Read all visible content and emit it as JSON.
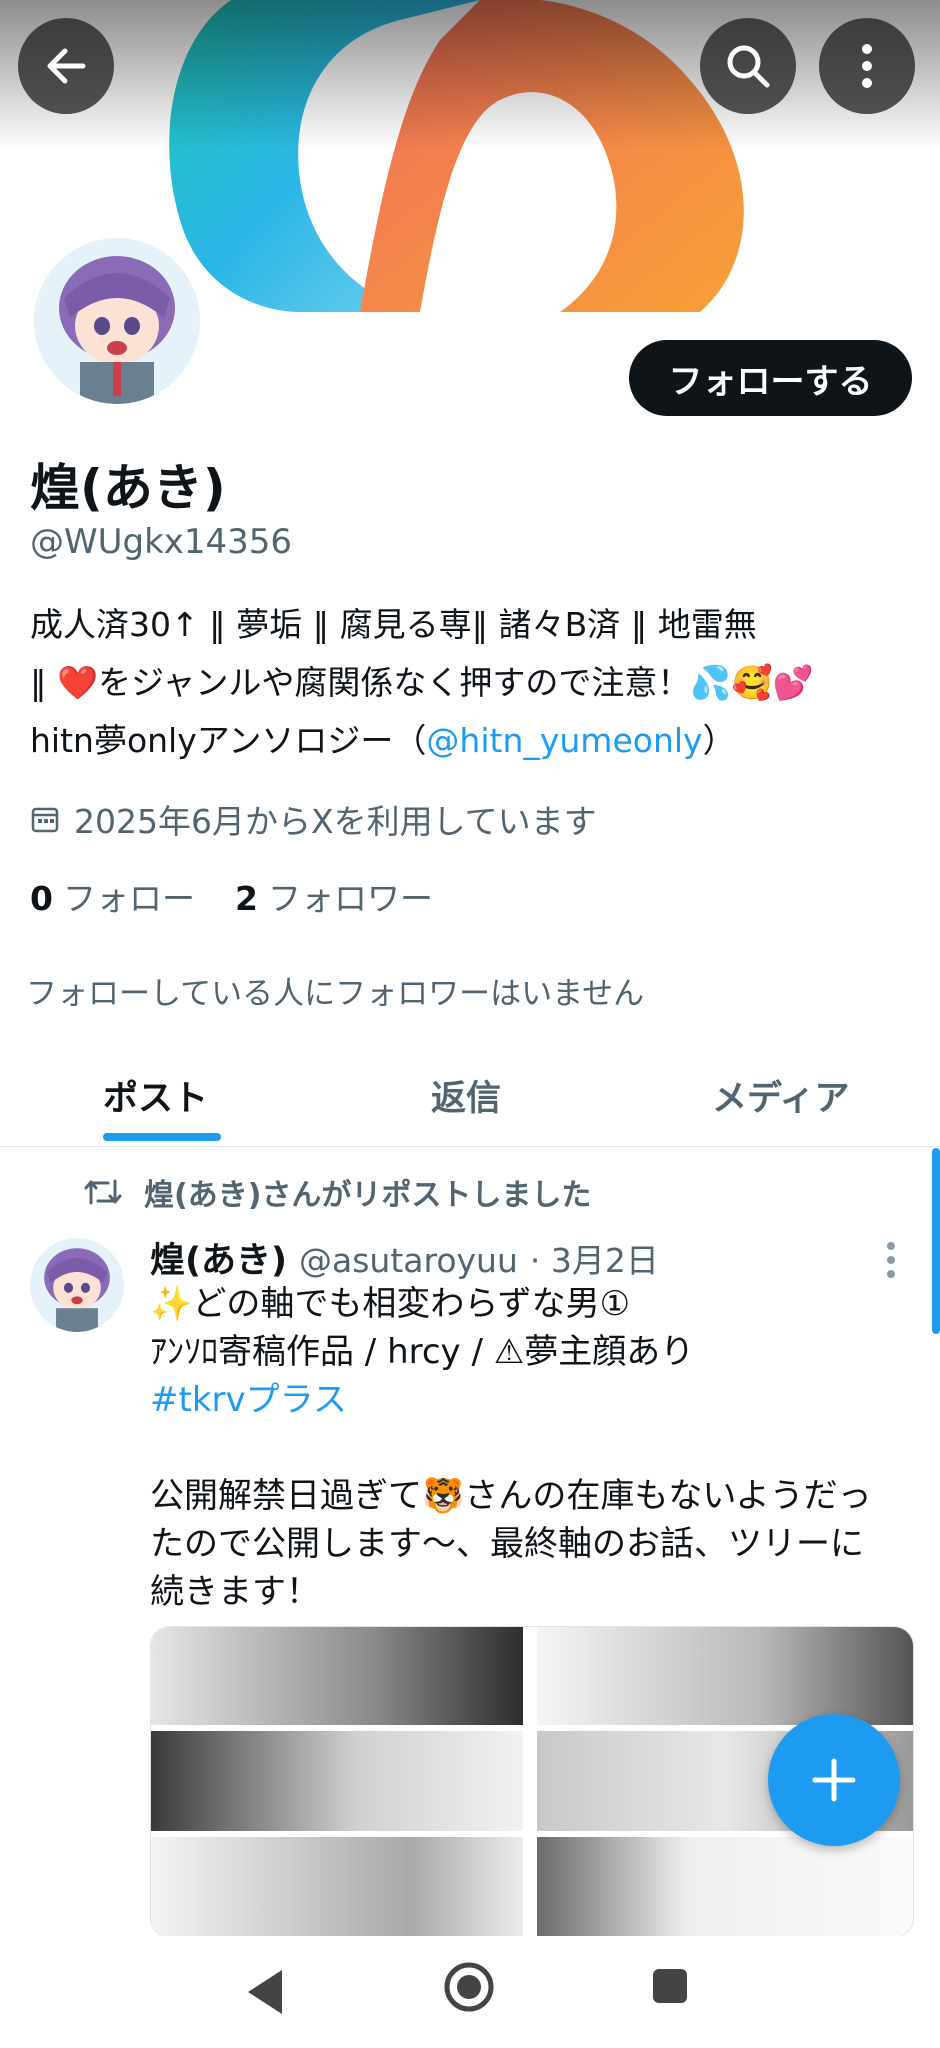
{
  "header": {
    "back_icon": "arrow-left-icon",
    "search_icon": "search-icon",
    "more_icon": "more-vertical-icon"
  },
  "profile": {
    "follow_label": "フォローする",
    "display_name": "煌(あき)",
    "handle": "@WUgkx14356",
    "bio_line1": "成人済30↑ ‖ 夢垢 ‖ 腐見る専‖ 諸々B済 ‖ 地雷無",
    "bio_line2": "‖ ❤️をジャンルや腐関係なく押すので注意！💦🥰💕",
    "bio_line3_prefix": "hitn夢onlyアンソロジー（",
    "bio_link": "@hitn_yumeonly",
    "bio_line3_suffix": "）",
    "joined": "2025年6月からXを利用しています",
    "following_count": "0",
    "following_label": "フォロー",
    "followers_count": "2",
    "followers_label": "フォロワー",
    "no_mutual": "フォローしている人にフォロワーはいません"
  },
  "tabs": {
    "posts": "ポスト",
    "replies": "返信",
    "media": "メディア"
  },
  "post": {
    "repost_label": "煌(あき)さんがリポストしました",
    "author_name": "煌(あき)",
    "author_handle": "@asutaroyuu",
    "date": "· 3月2日",
    "line1": "✨どの軸でも相変わらずな男①",
    "line2": "ｱﾝｿﾛ寄稿作品 / hrcy / ⚠夢主顔あり",
    "hashtag": "#tkrvプラス",
    "line4": "公開解禁日過ぎて🐯さんの在庫もないようだっ",
    "line5": "たので公開します〜、最終軸のお話、ツリーに",
    "line6": "続きます！"
  },
  "fab_icon": "plus-icon",
  "navbar": {
    "back": "nav-back-icon",
    "home": "nav-home-icon",
    "recents": "nav-recents-icon"
  },
  "colors": {
    "accent": "#1d9bf0",
    "text": "#0f1419",
    "secondary": "#536471"
  }
}
